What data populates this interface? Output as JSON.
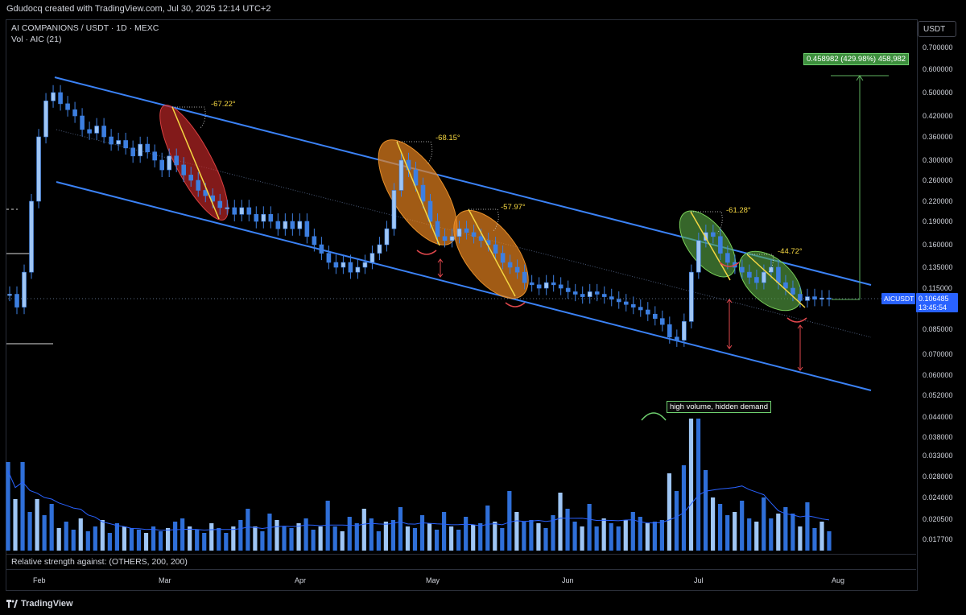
{
  "header": {
    "credit": "Gdudocq created with TradingView.com, Jul 30, 2025 12:14 UTC+2",
    "symbol_line": "AI COMPANIONS / USDT · 1D · MEXC",
    "volume_line": "Vol · AIC (21)",
    "currency": "USDT"
  },
  "footer": {
    "relative_strength": "Relative strength against: (OTHERS, 200, 200)",
    "brand": "TradingView"
  },
  "colors": {
    "candle": "#3d7fe0",
    "candle_hollow": "#9fc6f5",
    "channel": "#3b82f6",
    "volume_dark": "#2f6fd8",
    "volume_light": "#9fc6f5",
    "target": "#5fb35f",
    "red_arrow": "#e0474c",
    "angle_text": "#f5d742"
  },
  "chart_data": {
    "type": "candlestick",
    "title": "AI COMPANIONS / USDT · 1D · MEXC",
    "y_axis_ticks": [
      "0.700000",
      "0.600000",
      "0.500000",
      "0.420000",
      "0.360000",
      "0.300000",
      "0.260000",
      "0.220000",
      "0.190000",
      "0.160000",
      "0.135000",
      "0.115000",
      "0.085000",
      "0.070000",
      "0.060000",
      "0.052000",
      "0.044000",
      "0.038000",
      "0.033000",
      "0.028000",
      "0.024000",
      "0.020500",
      "0.017700"
    ],
    "y_scale": "log",
    "x_axis_ticks": [
      "Feb",
      "Mar",
      "Apr",
      "May",
      "Jun",
      "Jul",
      "Aug"
    ],
    "last_price": "0.106485",
    "countdown": "13:45:54",
    "price_label": "AICUSDT",
    "target_label": "0.458982 (429.98%) 458,982",
    "angle_labels": [
      "-67.22°",
      "-68.15°",
      "-57.97°",
      "-61.28°",
      "-44.72°"
    ],
    "annotation": "high volume, hidden demand",
    "close_series": [
      0.11,
      0.1,
      0.13,
      0.22,
      0.36,
      0.47,
      0.5,
      0.46,
      0.44,
      0.42,
      0.38,
      0.37,
      0.39,
      0.36,
      0.34,
      0.35,
      0.33,
      0.31,
      0.34,
      0.32,
      0.3,
      0.28,
      0.31,
      0.29,
      0.27,
      0.26,
      0.24,
      0.23,
      0.22,
      0.21,
      0.21,
      0.2,
      0.21,
      0.2,
      0.19,
      0.2,
      0.19,
      0.18,
      0.19,
      0.18,
      0.19,
      0.17,
      0.16,
      0.15,
      0.14,
      0.135,
      0.14,
      0.13,
      0.135,
      0.14,
      0.15,
      0.16,
      0.18,
      0.24,
      0.3,
      0.28,
      0.25,
      0.22,
      0.19,
      0.17,
      0.165,
      0.17,
      0.18,
      0.175,
      0.17,
      0.165,
      0.16,
      0.15,
      0.14,
      0.135,
      0.13,
      0.12,
      0.118,
      0.115,
      0.12,
      0.118,
      0.115,
      0.112,
      0.11,
      0.108,
      0.112,
      0.11,
      0.108,
      0.106,
      0.104,
      0.102,
      0.1,
      0.098,
      0.095,
      0.092,
      0.088,
      0.08,
      0.078,
      0.09,
      0.13,
      0.165,
      0.175,
      0.17,
      0.15,
      0.14,
      0.135,
      0.13,
      0.125,
      0.12,
      0.13,
      0.135,
      0.12,
      0.115,
      0.11,
      0.105,
      0.108,
      0.106,
      0.107,
      0.106
    ]
  }
}
